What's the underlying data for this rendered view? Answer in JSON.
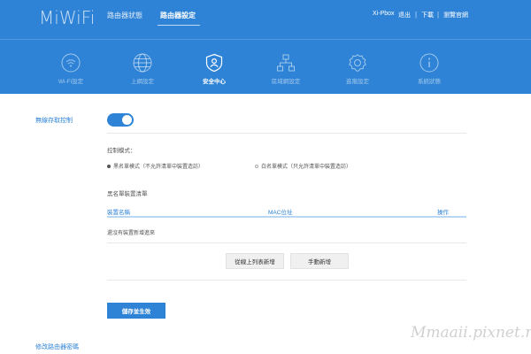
{
  "header": {
    "logo": "MiWiFi",
    "top_tabs": [
      "路由器狀態",
      "路由器設定"
    ],
    "active_top_tab": "路由器設定",
    "user": {
      "name": "Xi-Pbox",
      "logout": "退出",
      "download": "下載",
      "official": "瀏覽官網"
    },
    "nav": [
      {
        "label": "Wi-Fi設定",
        "icon": "wifi-icon"
      },
      {
        "label": "上網設定",
        "icon": "globe-icon"
      },
      {
        "label": "安全中心",
        "icon": "security-shield-icon",
        "active": true
      },
      {
        "label": "區域網設定",
        "icon": "network-icon"
      },
      {
        "label": "進階設定",
        "icon": "gear-icon"
      },
      {
        "label": "系統狀態",
        "icon": "info-icon"
      }
    ]
  },
  "wireless_access": {
    "title": "無線存取控制",
    "enabled": true,
    "control_mode_label": "控制模式：",
    "mode_options": [
      {
        "label": "黑名單模式（不允許清單中裝置造訪）",
        "selected": true
      },
      {
        "label": "白名單模式（只允許清單中裝置造訪）",
        "selected": false
      }
    ],
    "blacklist_title": "黑名單裝置清單",
    "columns": [
      "裝置名稱",
      "MAC位址",
      "操作"
    ],
    "empty_text": "還沒有裝置新增進來",
    "add_from_list": "從線上列表新增",
    "add_manual": "手動新增",
    "save": "儲存並生效"
  },
  "next_section": "修改路由器密碼",
  "watermark": "Mmaaii.pixnet.net",
  "colors": {
    "header_blue": "#2e83d6",
    "accent": "#2e83d6"
  }
}
